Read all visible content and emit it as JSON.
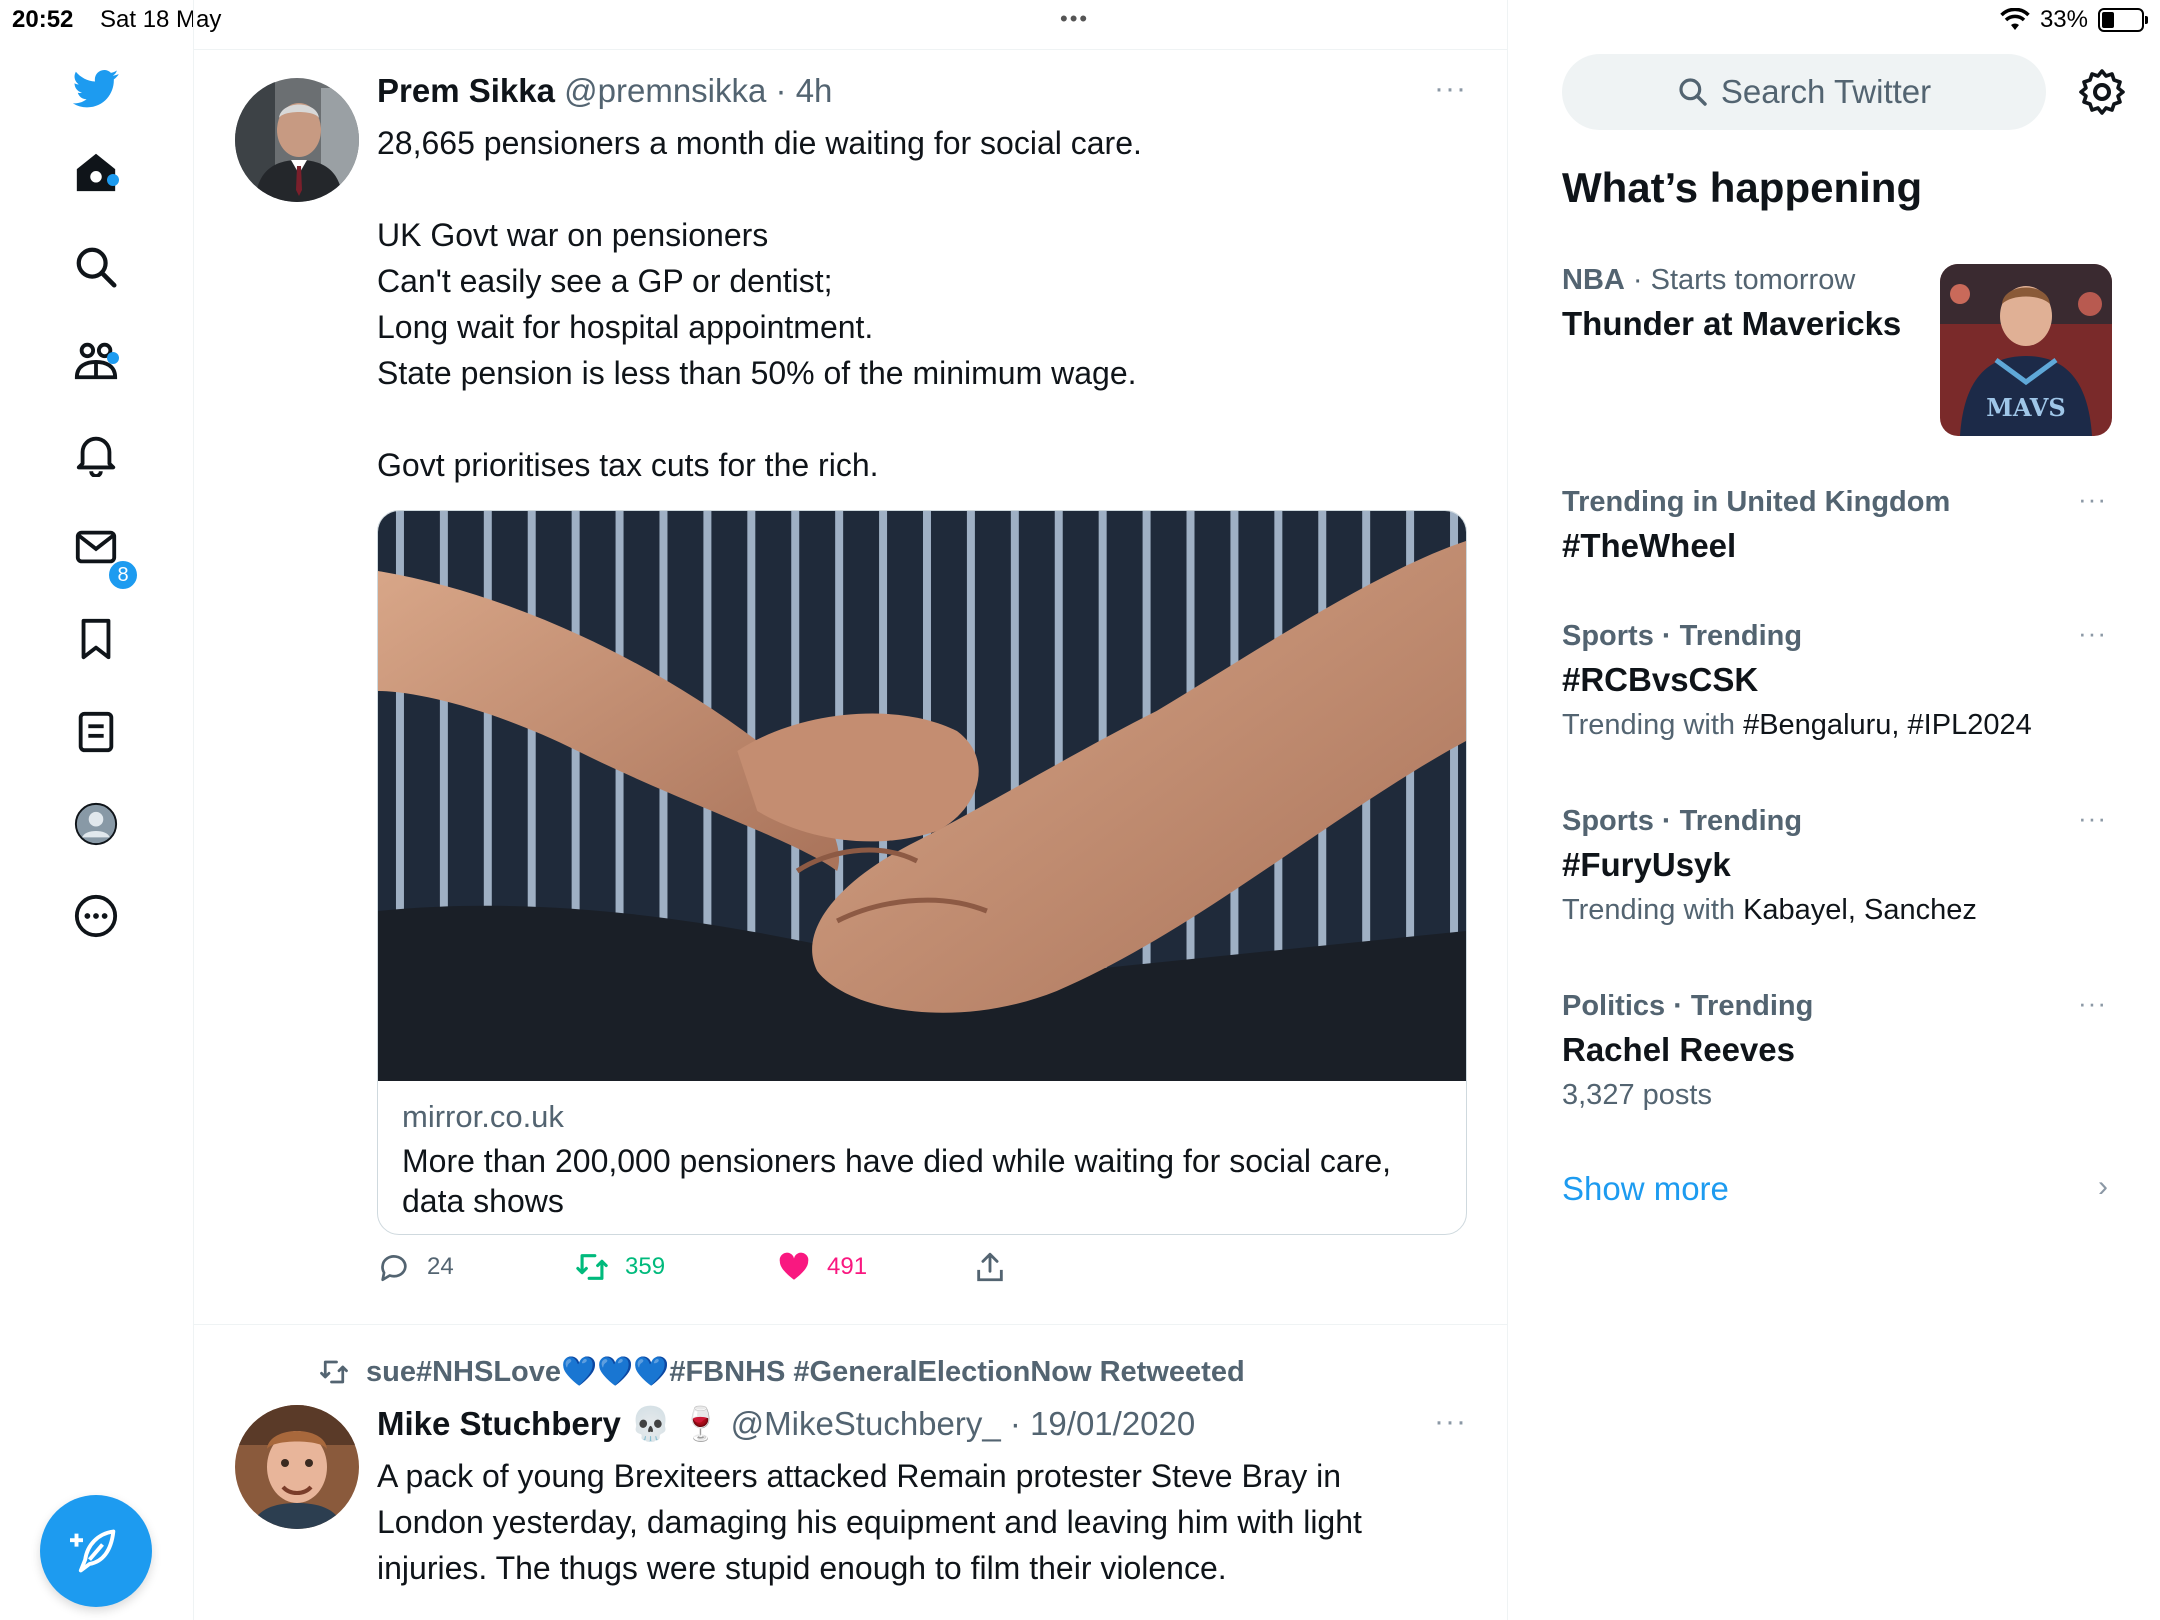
{
  "status_bar": {
    "time": "20:52",
    "date": "Sat 18 May",
    "battery": "33%",
    "top_dots": "•••"
  },
  "nav": {
    "notifications_count": "8",
    "icons": [
      "twitter-logo-icon",
      "home-icon",
      "search-icon",
      "communities-icon",
      "notifications-icon",
      "messages-icon",
      "bookmarks-icon",
      "lists-icon",
      "profile-icon",
      "more-icon",
      "compose-icon"
    ]
  },
  "tweet1": {
    "name": "Prem Sikka",
    "handle": "@premnsikka",
    "time": "· 4h",
    "more": "···",
    "lines": [
      "28,665 pensioners a month die waiting for social care.",
      "",
      "UK Govt war on pensioners",
      "Can't easily see a GP or dentist;",
      "Long wait for hospital appointment.",
      "State pension is less than 50% of the minimum wage.",
      "",
      "Govt prioritises tax cuts for the rich."
    ],
    "card": {
      "domain": "mirror.co.uk",
      "title": "More than 200,000 pensioners have died while waiting for social care, data shows"
    },
    "replies": "24",
    "retweets": "359",
    "likes": "491"
  },
  "tweet2": {
    "retweeted_by_prefix": "sue#NHSLove",
    "retweeted_by_hearts": "💙💙💙",
    "retweeted_by_suffix": "#FBNHS #GeneralElectionNow Retweeted",
    "name": "Mike Stuchbery",
    "name_emoji": "💀 🍷",
    "handle": "@MikeStuchbery_",
    "time": "· 19/01/2020",
    "more": "···",
    "text": "A pack of young Brexiteers attacked Remain protester Steve Bray in London yesterday, damaging his equipment and leaving him with light injuries. The thugs were stupid enough to film their violence."
  },
  "sidebar": {
    "search_placeholder": "Search Twitter",
    "title": "What’s happening",
    "featured": {
      "meta_cat": "NBA",
      "meta_rest": " · Starts tomorrow",
      "name": "Thunder at Mavericks",
      "image_text": "MAVS"
    },
    "trends": [
      {
        "meta": "Trending in United Kingdom",
        "name": "#TheWheel",
        "sub_label": "",
        "sub_value": ""
      },
      {
        "meta": "Sports · Trending",
        "name": "#RCBvsCSK",
        "sub_label": "Trending with ",
        "sub_value": "#Bengaluru, #IPL2024"
      },
      {
        "meta": "Sports · Trending",
        "name": "#FuryUsyk",
        "sub_label": "Trending with ",
        "sub_value": "Kabayel, Sanchez"
      },
      {
        "meta": "Politics · Trending",
        "name": "Rachel Reeves",
        "sub_label": "3,327 posts",
        "sub_value": ""
      }
    ],
    "trend_more": "···",
    "show_more": "Show more",
    "chevron": "›"
  },
  "colors": {
    "accent": "#1d9bf0",
    "retweet": "#00ba7c",
    "like": "#f91880",
    "muted": "#536471"
  }
}
